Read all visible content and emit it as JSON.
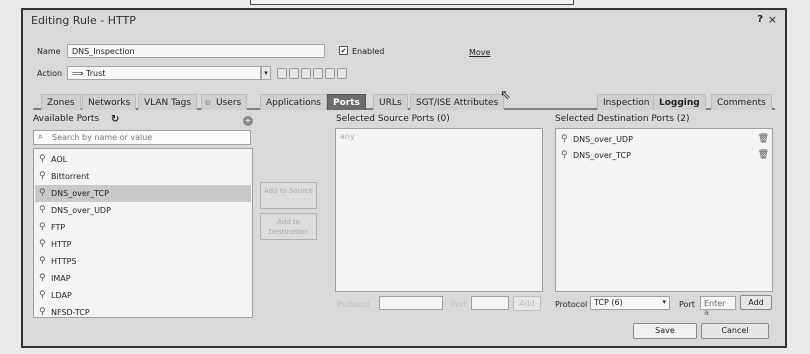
{
  "dialog": {
    "title": "Editing Rule - HTTP",
    "help": "?",
    "close": "×"
  },
  "rule": {
    "name_label": "Name",
    "name_value": "DNS_Inspection",
    "enabled_label": "Enabled",
    "enabled_checked": "✔",
    "move_link": "Move",
    "action_label": "Action",
    "action_value": "⟹ Trust"
  },
  "tabs": [
    {
      "label": "Zones"
    },
    {
      "label": "Networks"
    },
    {
      "label": "VLAN Tags"
    },
    {
      "label": "Users"
    },
    {
      "label": "Applications"
    },
    {
      "label": "Ports"
    },
    {
      "label": "URLs"
    },
    {
      "label": "SGT/ISE Attributes"
    },
    {
      "label": "Inspection"
    },
    {
      "label": "Logging"
    },
    {
      "label": "Comments"
    }
  ],
  "available": {
    "title": "Available Ports",
    "search_placeholder": "Search by name or value",
    "items": [
      "AOL",
      "Bittorrent",
      "DNS_over_TCP",
      "DNS_over_UDP",
      "FTP",
      "HTTP",
      "HTTPS",
      "IMAP",
      "LDAP",
      "NFSD-TCP"
    ]
  },
  "middle": {
    "add_to_source": "Add to Source",
    "add_to_destination": "Add to Destination"
  },
  "source": {
    "title": "Selected Source Ports (0)",
    "placeholder": "any",
    "protocol_label": "Protocol",
    "port_label": "Port",
    "add_label": "Add"
  },
  "destination": {
    "title": "Selected Destination Ports (2)",
    "items": [
      "DNS_over_UDP",
      "DNS_over_TCP"
    ],
    "protocol_label": "Protocol",
    "protocol_value": "TCP (6)",
    "port_label": "Port",
    "port_placeholder": "Enter a",
    "add_label": "Add"
  },
  "footer": {
    "save": "Save",
    "cancel": "Cancel"
  }
}
